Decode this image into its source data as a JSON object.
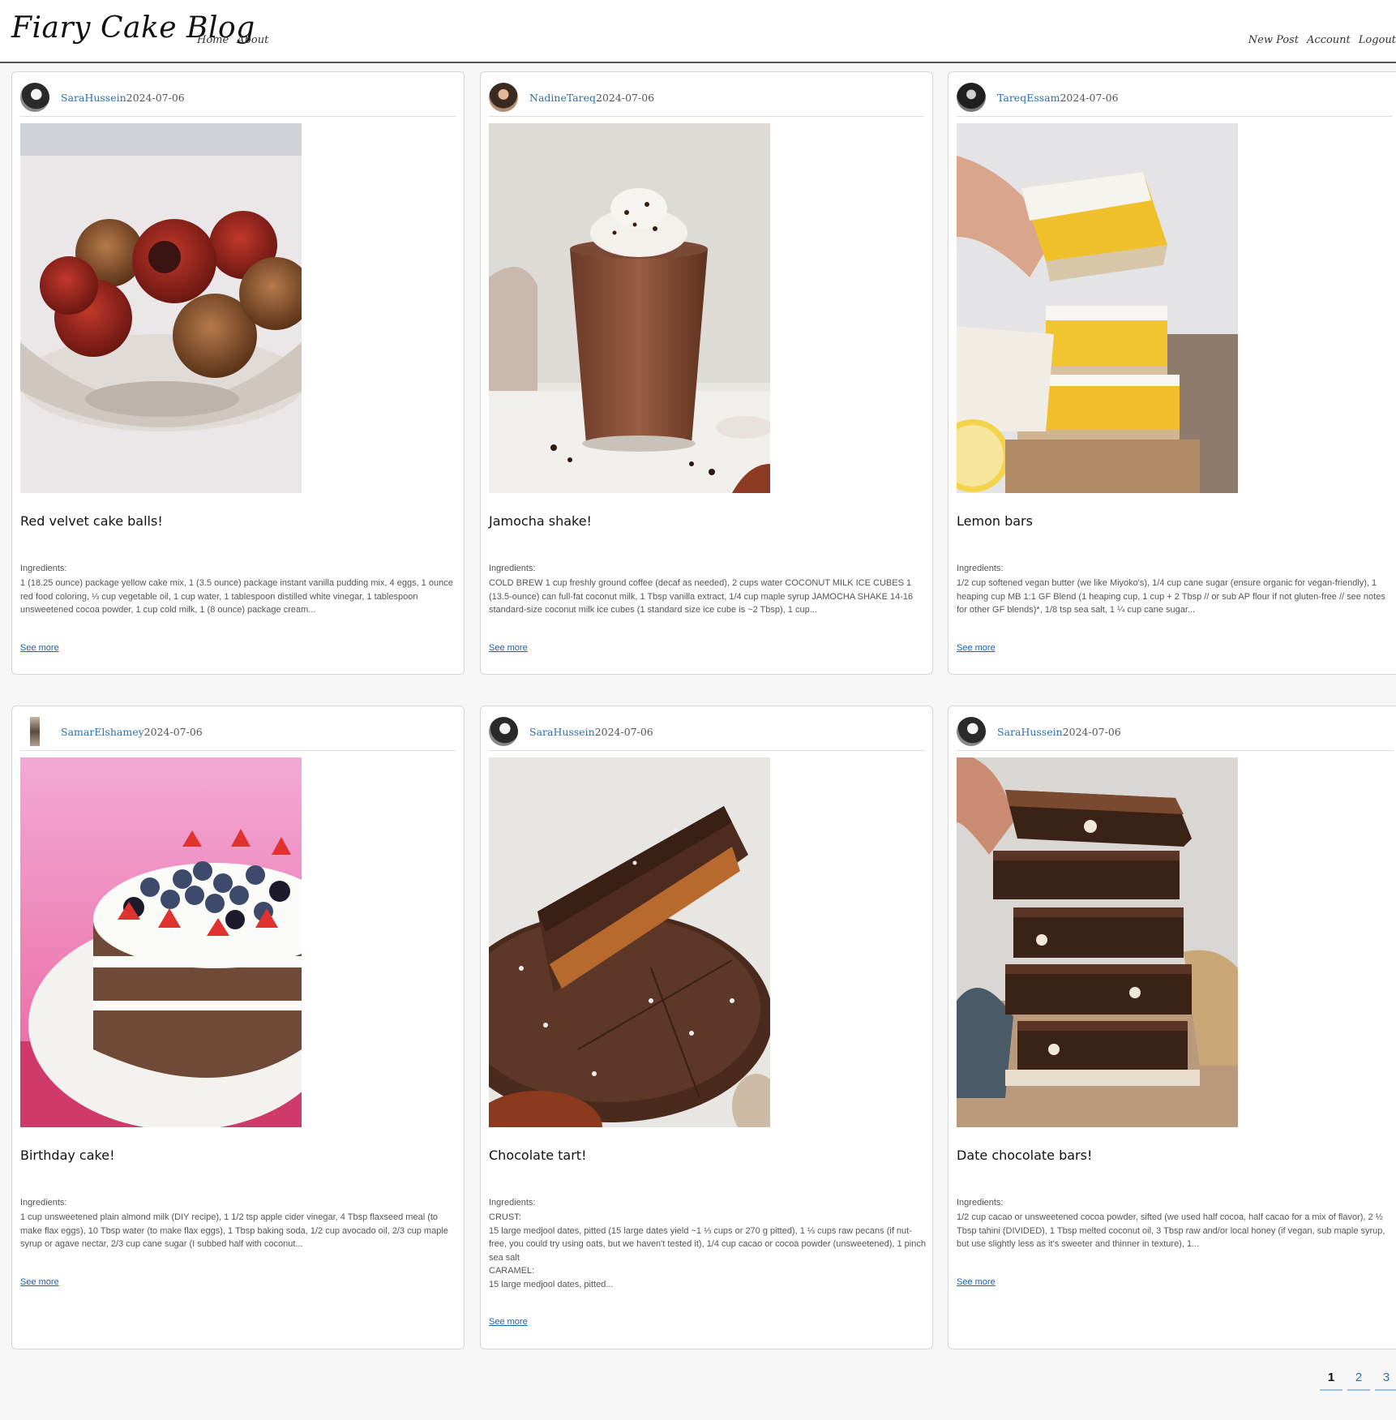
{
  "header": {
    "brand": "Fiary Cake Blog",
    "nav_left": [
      "Home",
      "About"
    ],
    "nav_right": [
      "New Post",
      "Account",
      "Logout"
    ]
  },
  "posts": [
    {
      "author": "SaraHussein",
      "date": "2024-07-06",
      "title": "Red velvet cake balls!",
      "ingredients_label": "Ingredients:",
      "ingredients": "1 (18.25 ounce) package yellow cake mix, 1 (3.5 ounce) package instant vanilla pudding mix, 4 eggs, 1 ounce red food coloring, ⅓ cup vegetable oil, 1 cup water, 1 tablespoon distilled white vinegar, 1 tablespoon unsweetened cocoa powder, 1 cup cold milk, 1 (8 ounce) package cream...",
      "see_more": "See more"
    },
    {
      "author": "NadineTareq",
      "date": "2024-07-06",
      "title": "Jamocha shake!",
      "ingredients_label": "Ingredients:",
      "ingredients": "COLD BREW 1 cup freshly ground coffee (decaf as needed), 2 cups water COCONUT MILK ICE CUBES 1 (13.5-ounce) can full-fat coconut milk, 1 Tbsp vanilla extract, 1/4 cup maple syrup JAMOCHA SHAKE 14-16 standard-size coconut milk ice cubes (1 standard size ice cube is ~2 Tbsp), 1 cup...",
      "see_more": "See more"
    },
    {
      "author": "TareqEssam",
      "date": "2024-07-06",
      "title": "Lemon bars",
      "ingredients_label": "Ingredients:",
      "ingredients": "1/2 cup softened vegan butter (we like Miyoko's), 1/4 cup cane sugar (ensure organic for vegan-friendly), 1 heaping cup MB 1:1 GF Blend (1 heaping cup, 1 cup + 2 Tbsp // or sub AP flour if not gluten-free // see notes for other GF blends)*, 1/8 tsp sea salt, 1 ¼ cup cane sugar...",
      "see_more": "See more"
    },
    {
      "author": "SamarElshamey",
      "date": "2024-07-06",
      "title": "Birthday cake!",
      "ingredients_label": "Ingredients:",
      "ingredients": "1 cup unsweetened plain almond milk (DIY recipe), 1 1/2 tsp apple cider vinegar, 4 Tbsp flaxseed meal (to make flax eggs), 10 Tbsp water (to make flax eggs), 1 Tbsp baking soda, 1/2 cup avocado oil, 2/3 cup maple syrup or agave nectar, 2/3 cup cane sugar (I subbed half with coconut...",
      "see_more": "See more"
    },
    {
      "author": "SaraHussein",
      "date": "2024-07-06",
      "title": "Chocolate tart!",
      "ingredients_label": "Ingredients:",
      "ingredients": "CRUST:\n15 large medjool dates, pitted (15 large dates yield ~1 ⅓ cups or 270 g pitted), 1 ⅓ cups raw pecans (if nut-free, you could try using oats, but we haven't tested it), 1/4 cup cacao or cocoa powder (unsweetened), 1 pinch sea salt\nCARAMEL:\n15 large medjool dates, pitted...",
      "see_more": "See more"
    },
    {
      "author": "SaraHussein",
      "date": "2024-07-06",
      "title": "Date chocolate bars!",
      "ingredients_label": "Ingredients:",
      "ingredients": "1/2 cup cacao or unsweetened cocoa powder, sifted (we used half cocoa, half cacao for a mix of flavor), 2 ½ Tbsp tahini (DIVIDED), 1 Tbsp melted coconut oil, 3 Tbsp raw and/or local honey (if vegan, sub maple syrup, but use slightly less as it's sweeter and thinner in texture), 1...",
      "see_more": "See more"
    }
  ],
  "pagination": [
    "1",
    "2",
    "3"
  ]
}
